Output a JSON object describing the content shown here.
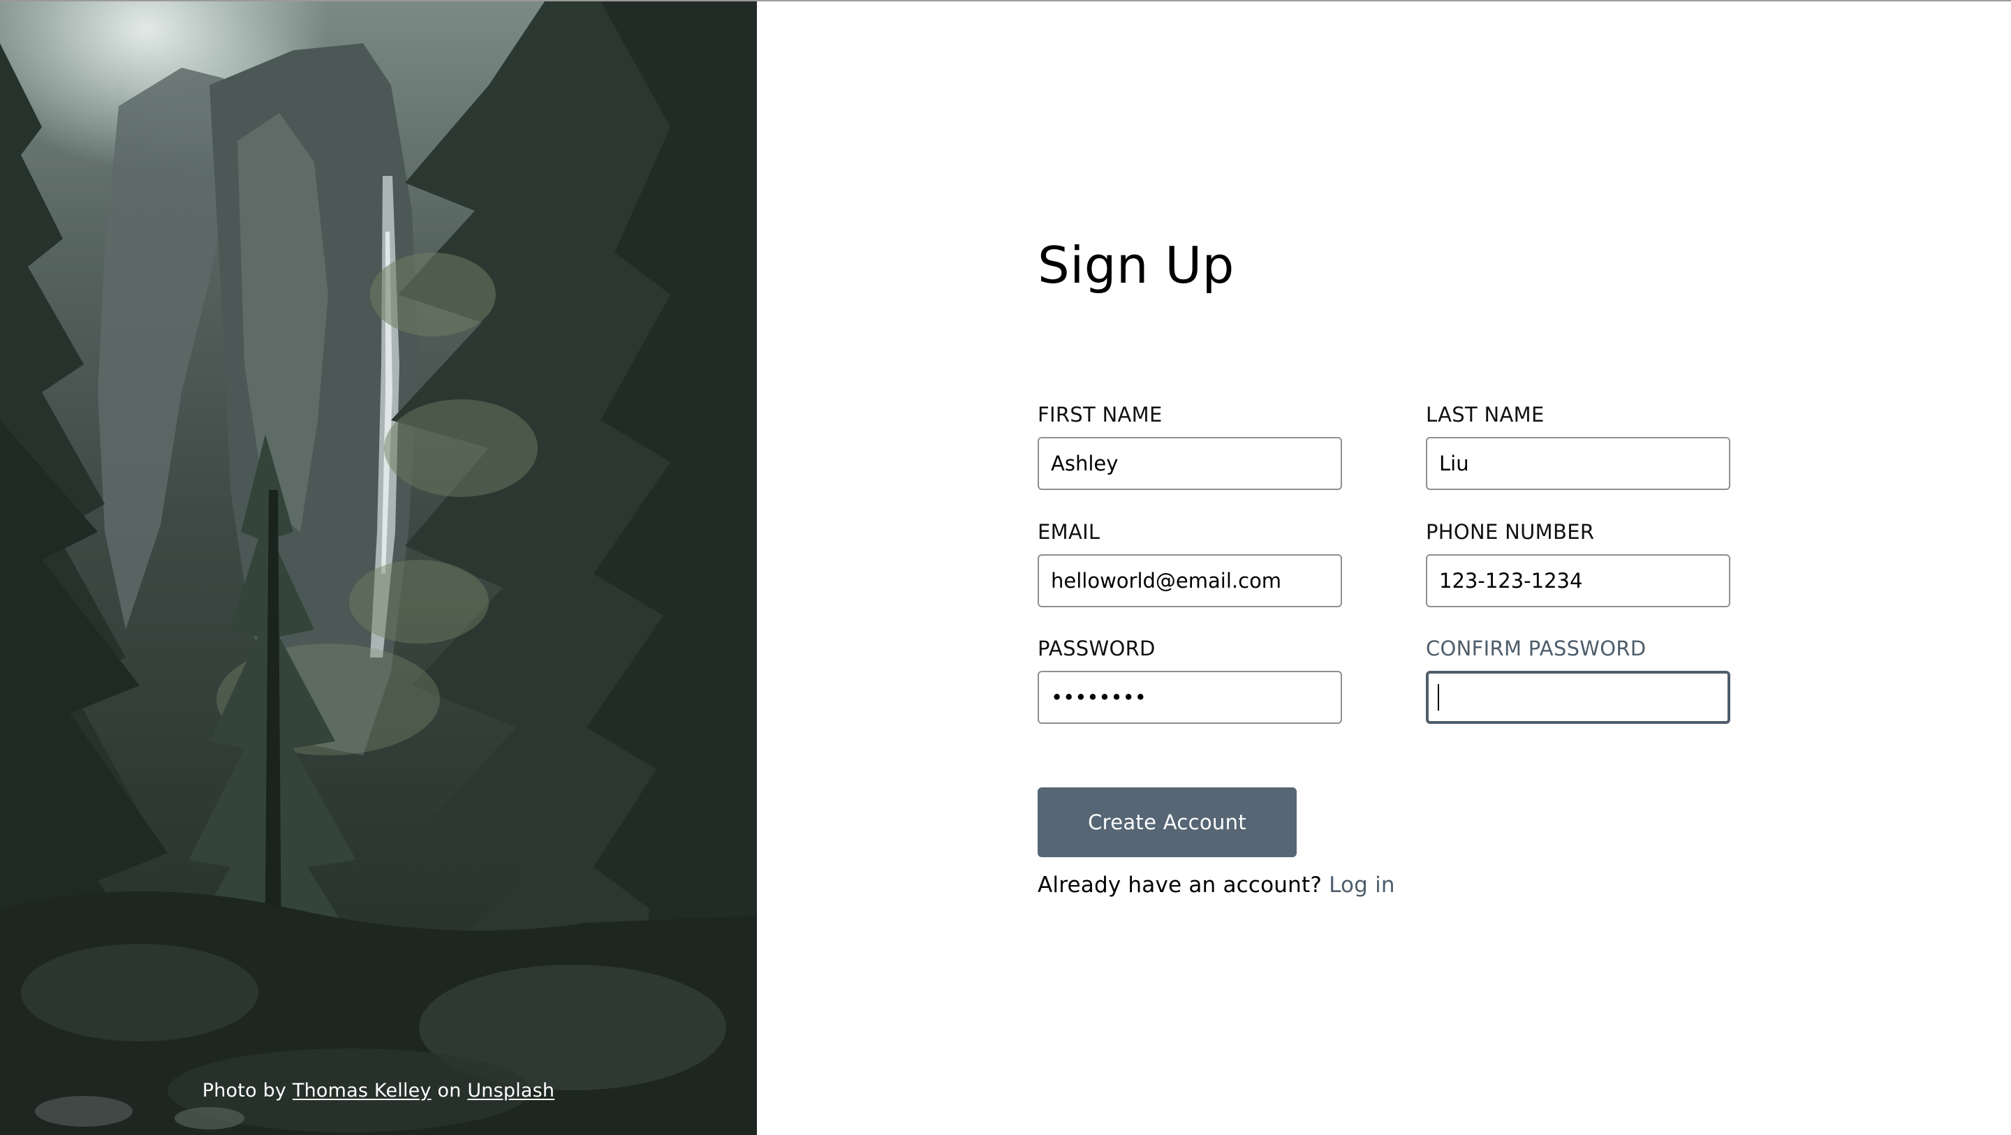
{
  "hero": {
    "credit_prefix": "Photo by",
    "photographer": "Thomas Kelley",
    "credit_middle": "on",
    "source": "Unsplash"
  },
  "form": {
    "title": "Sign Up",
    "fields": {
      "first_name": {
        "label": "FIRST NAME",
        "value": "Ashley"
      },
      "last_name": {
        "label": "LAST NAME",
        "value": "Liu"
      },
      "email": {
        "label": "EMAIL",
        "value": "helloworld@email.com"
      },
      "phone": {
        "label": "PHONE NUMBER",
        "value": "123-123-1234"
      },
      "password": {
        "label": "PASSWORD",
        "value": "••••••••"
      },
      "confirm_password": {
        "label": "CONFIRM PASSWORD",
        "value": ""
      }
    },
    "submit_label": "Create Account",
    "login_prompt": "Already have an account?",
    "login_link": "Log in"
  },
  "colors": {
    "accent": "#566675",
    "focus": "#4e5d6b",
    "input_border": "#8f8f8f"
  }
}
